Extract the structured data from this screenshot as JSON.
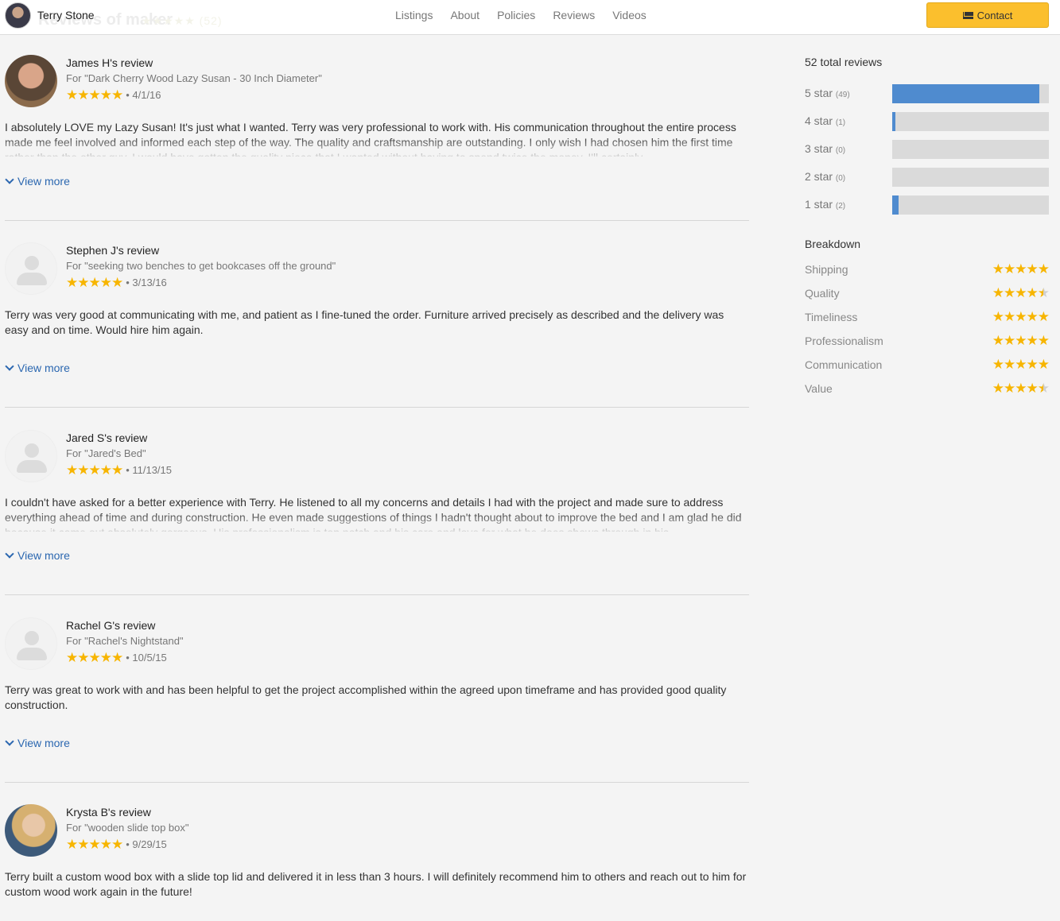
{
  "header": {
    "maker_name": "Terry Stone",
    "nav": [
      "Listings",
      "About",
      "Policies",
      "Reviews",
      "Videos"
    ],
    "contact_label": "Contact",
    "ghost_title": "Reviews of maker",
    "ghost_count": "(52)"
  },
  "reviews": [
    {
      "name": "James H's review",
      "for": "For \"Dark Cherry Wood Lazy Susan - 30 Inch Diameter\"",
      "rating": 5,
      "date": "• 4/1/16",
      "text": "I absolutely LOVE my Lazy Susan! It's just what I wanted. Terry was very professional to work with. His communication throughout the entire process made me feel involved and informed each step of the way. The quality and craftsmanship are outstanding. I only wish I had chosen him the first time rather than the other guy. I would have gotten the quality piece that I wanted without having to spend twice the money. I'll certainly",
      "view_more": "View more"
    },
    {
      "name": "Stephen J's review",
      "for": "For \"seeking two benches to get bookcases off the ground\"",
      "rating": 5,
      "date": "• 3/13/16",
      "text": "Terry was very good at communicating with me, and patient as I fine-tuned the order. Furniture arrived precisely as described and the delivery was easy and on time. Would hire him again.",
      "view_more": "View more"
    },
    {
      "name": "Jared S's review",
      "for": "For \"Jared's Bed\"",
      "rating": 5,
      "date": "• 11/13/15",
      "text": "I couldn't have asked for a better experience with Terry. He listened to all my concerns and details I had with the project and made sure to address everything ahead of time and during construction. He even made suggestions of things I hadn't thought about to improve the bed and I am glad he did because it came out absolutely gorgeous. His professionalism is top notch and his care and love for what he does shows through in his",
      "view_more": "View more"
    },
    {
      "name": "Rachel G's review",
      "for": "For \"Rachel's Nightstand\"",
      "rating": 5,
      "date": "• 10/5/15",
      "text": "Terry was great to work with and has been helpful to get the project accomplished within the agreed upon timeframe and has provided good quality construction.",
      "view_more": "View more"
    },
    {
      "name": "Krysta B's review",
      "for": "For \"wooden slide top box\"",
      "rating": 5,
      "date": "• 9/29/15",
      "text": "Terry built a custom wood box with a slide top lid and delivered it in less than 3 hours. I will definitely recommend him to others and reach out to him for custom wood work again in the future!"
    }
  ],
  "summary": {
    "total": "52 total reviews",
    "distribution": [
      {
        "label": "5 star",
        "count": "(49)",
        "fraction": 0.94
      },
      {
        "label": "4 star",
        "count": "(1)",
        "fraction": 0.02
      },
      {
        "label": "3 star",
        "count": "(0)",
        "fraction": 0.0
      },
      {
        "label": "2 star",
        "count": "(0)",
        "fraction": 0.0
      },
      {
        "label": "1 star",
        "count": "(2)",
        "fraction": 0.04
      }
    ],
    "breakdown_title": "Breakdown",
    "breakdown": [
      {
        "label": "Shipping",
        "rating": 5
      },
      {
        "label": "Quality",
        "rating": 4.5
      },
      {
        "label": "Timeliness",
        "rating": 5
      },
      {
        "label": "Professionalism",
        "rating": 5
      },
      {
        "label": "Communication",
        "rating": 5
      },
      {
        "label": "Value",
        "rating": 4.5
      }
    ]
  },
  "colors": {
    "accent": "#fbbf2d",
    "star": "#f7b500",
    "bar": "#4f8bcf",
    "link": "#2b67b0"
  },
  "icons": {
    "contact": "envelope-icon",
    "view_more": "chevron-down-icon"
  }
}
